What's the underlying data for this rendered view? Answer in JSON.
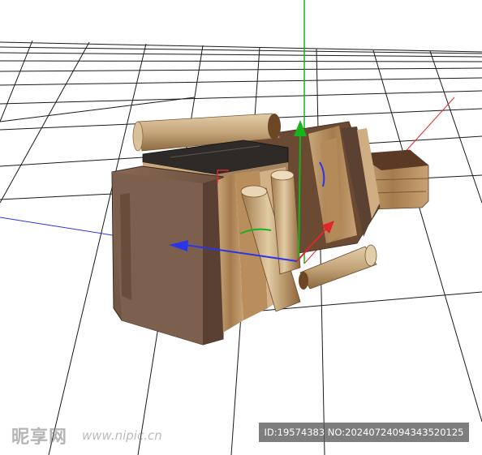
{
  "viewport": {
    "background": "#ffffff",
    "grid_color": "#1a1a1a",
    "axis_colors": {
      "x": "#e0262b",
      "y": "#17b31a",
      "z": "#2a36e6"
    }
  },
  "gizmo": {
    "icons": [
      "move-arrow-x-icon",
      "move-arrow-y-icon",
      "move-arrow-z-icon"
    ]
  },
  "scene_object": {
    "kind": "stack-of-old-books-and-scrolls"
  },
  "watermark": {
    "logo_text": "昵享网",
    "url_text": "www.nipic.cn",
    "id_text": "ID:19574383 NO:20240724094343520125"
  }
}
